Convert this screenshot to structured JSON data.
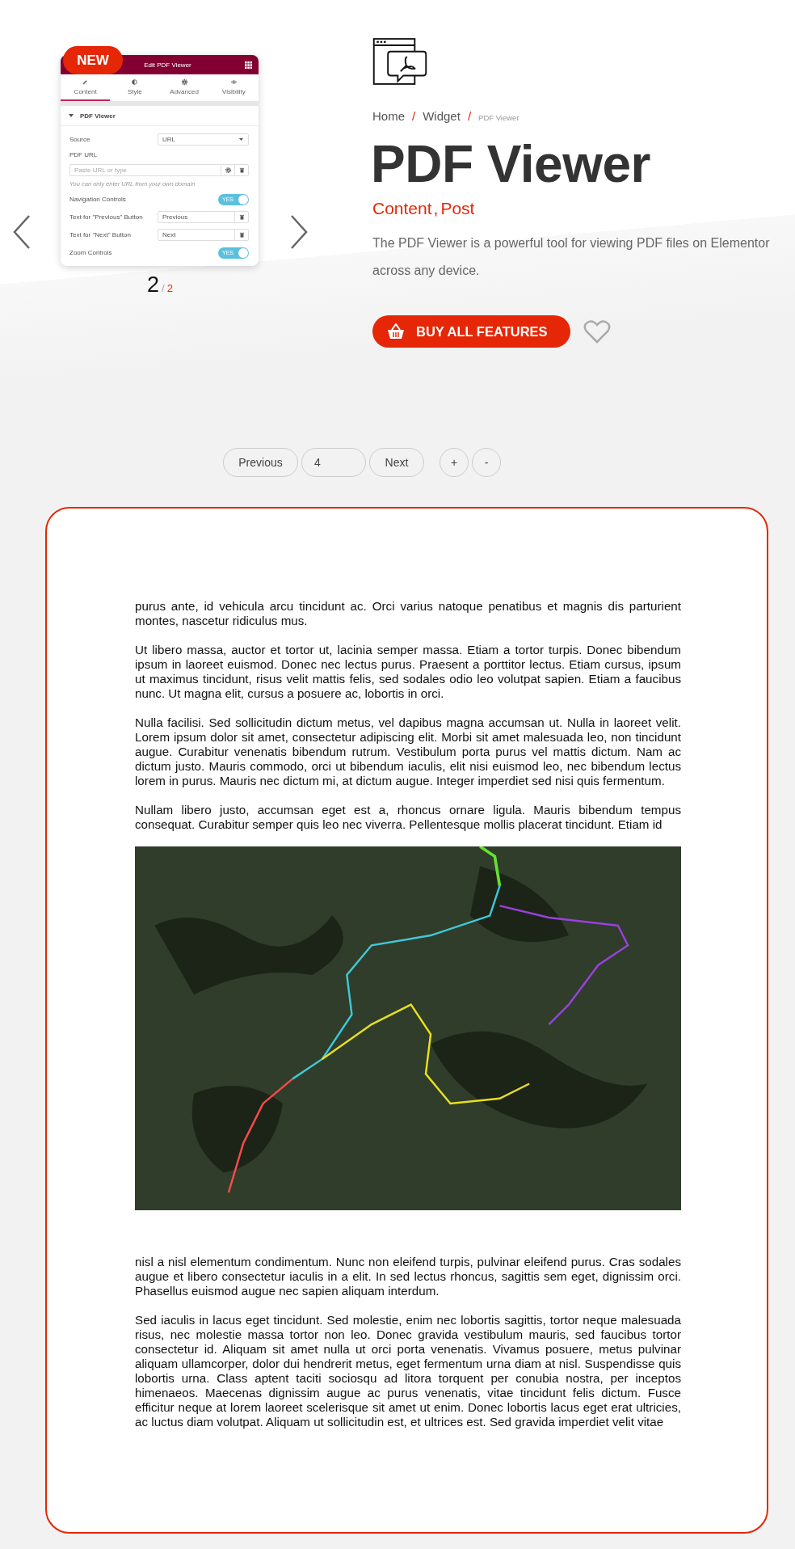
{
  "preview": {
    "badge": "NEW",
    "panel_title": "Edit PDF Viewer",
    "tabs": [
      {
        "label": "Content",
        "kind": "pencil",
        "selected": true
      },
      {
        "label": "Style",
        "kind": "contrast",
        "selected": false
      },
      {
        "label": "Advanced",
        "kind": "gear",
        "selected": false
      },
      {
        "label": "Visibility",
        "kind": "eye",
        "selected": false
      }
    ],
    "section_title": "PDF Viewer",
    "fields": [
      {
        "kind": "select",
        "label": "Source",
        "value": "URL"
      },
      {
        "kind": "url",
        "label": "PDF URL",
        "placeholder": "Paste URL or type",
        "hint": "You can only enter URL from your own domain"
      },
      {
        "kind": "toggle",
        "label": "Navigation Controls",
        "on": true,
        "toggle_text": "YES"
      },
      {
        "kind": "text",
        "label": "Text for \"Previous\" Button",
        "value": "Previous"
      },
      {
        "kind": "text",
        "label": "Text for \"Next\" Button",
        "value": "Next"
      },
      {
        "kind": "toggle",
        "label": "Zoom Controls",
        "on": true,
        "toggle_text": "YES"
      }
    ],
    "slide_current": "2",
    "slide_separator": "/",
    "slide_total": "2"
  },
  "breadcrumb": [
    {
      "label": "Home",
      "separator": "/"
    },
    {
      "label": "Widget",
      "separator": "/"
    },
    {
      "label": "PDF Viewer"
    }
  ],
  "title": "PDF Viewer",
  "tags": [
    {
      "label": "Content",
      "separator": ","
    },
    {
      "label": "Post"
    }
  ],
  "description": "The PDF Viewer is a powerful tool for viewing PDF files on Elementor across any device.",
  "buy_button": "BUY ALL FEATURES",
  "pager": {
    "previous": "Previous",
    "page": "4",
    "next": "Next",
    "zoom_in": "+",
    "zoom_out": "-"
  },
  "document": {
    "paragraphs_before": [
      "purus ante, id vehicula arcu tincidunt ac. Orci varius natoque penatibus et magnis dis parturient montes, nascetur ridiculus mus.",
      "Ut libero massa, auctor et tortor ut, lacinia semper massa. Etiam a tortor turpis. Donec bibendum ipsum in laoreet euismod. Donec nec lectus purus. Praesent a porttitor lectus. Etiam cursus, ipsum ut maximus tincidunt, risus velit mattis felis, sed sodales odio leo volutpat sapien. Etiam a faucibus nunc. Ut magna elit, cursus a posuere ac, lobortis in orci.",
      "Nulla facilisi. Sed sollicitudin dictum metus, vel dapibus magna accumsan ut. Nulla in laoreet velit. Lorem ipsum dolor sit amet, consectetur adipiscing elit. Morbi sit amet malesuada leo, non tincidunt augue. Curabitur venenatis bibendum rutrum. Vestibulum porta purus vel mattis dictum. Nam ac dictum justo. Mauris commodo, orci ut bibendum iaculis, elit nisi euismod leo, nec bibendum lectus lorem in purus. Mauris nec dictum mi, at dictum augue. Integer imperdiet sed nisi quis fermentum.",
      "Nullam libero justo, accumsan eget est a, rhoncus ornare ligula. Mauris bibendum tempus consequat. Curabitur semper quis leo nec viverra. Pellentesque mollis placerat tincidunt. Etiam id"
    ],
    "paragraphs_after": [
      "nisl a nisl elementum condimentum. Nunc non eleifend turpis, pulvinar eleifend purus. Cras sodales augue et libero consectetur iaculis in a elit. In sed lectus rhoncus, sagittis sem eget, dignissim orci. Phasellus euismod augue nec sapien aliquam interdum.",
      "Sed iaculis in lacus eget tincidunt. Sed molestie, enim nec lobortis sagittis, tortor neque malesuada risus, nec molestie massa tortor non leo. Donec gravida vestibulum mauris, sed faucibus tortor consectetur id. Aliquam sit amet nulla ut orci porta venenatis. Vivamus posuere, metus pulvinar aliquam ullamcorper, dolor dui hendrerit metus, eget fermentum urna diam at nisl. Suspendisse quis lobortis urna. Class aptent taciti sociosqu ad litora torquent per conubia nostra, per inceptos himenaeos. Maecenas dignissim augue ac purus venenatis, vitae tincidunt felis dictum. Fusce efficitur neque at lorem laoreet scelerisque sit amet ut enim. Donec lobortis lacus eget erat ultricies, ac luctus diam volutpat. Aliquam ut sollicitudin est, et ultrices est. Sed gravida imperdiet velit vitae"
    ]
  }
}
